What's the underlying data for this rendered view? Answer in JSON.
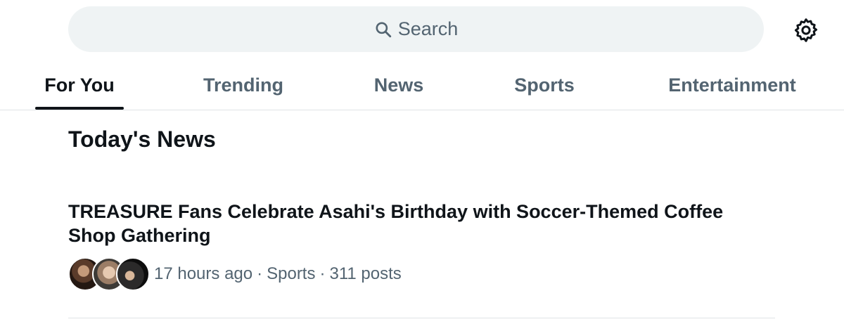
{
  "search": {
    "placeholder": "Search",
    "icon": "search-icon"
  },
  "settings": {
    "icon": "gear-icon"
  },
  "tabs": [
    {
      "label": "For You",
      "active": true
    },
    {
      "label": "Trending",
      "active": false
    },
    {
      "label": "News",
      "active": false
    },
    {
      "label": "Sports",
      "active": false
    },
    {
      "label": "Entertainment",
      "active": false
    }
  ],
  "section": {
    "title": "Today's News"
  },
  "news": [
    {
      "headline": "TREASURE Fans Celebrate Asahi's Birthday with Soccer-Themed Coffee Shop Gathering",
      "time": "17 hours ago",
      "separator": "·",
      "category": "Sports",
      "posts": "311 posts"
    }
  ],
  "colors": {
    "text_primary": "#0f1419",
    "text_secondary": "#536471",
    "search_bg": "#eff3f4",
    "divider": "#dfe3e6"
  }
}
